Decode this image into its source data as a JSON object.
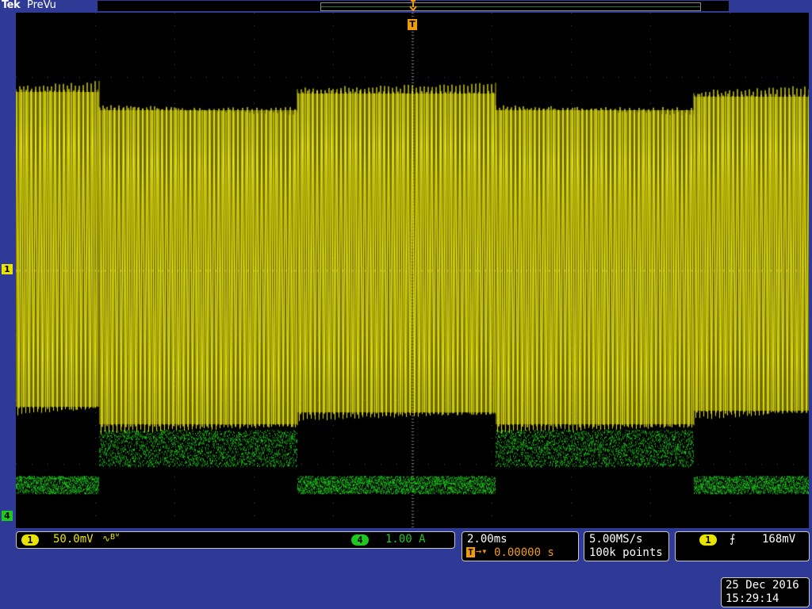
{
  "header": {
    "brand": "Tek",
    "status": "PreVu"
  },
  "markers": {
    "ch1": "1",
    "ch4": "4",
    "trigger": "T"
  },
  "channel1": {
    "label": "1",
    "scale": "50.0mV",
    "coupling_symbol": "∿",
    "bw_symbol": "Bᵂ",
    "color": "#e8e400"
  },
  "channel4": {
    "label": "4",
    "scale": "1.00 A",
    "color": "#1ec81e"
  },
  "horizontal": {
    "timebase": "2.00ms",
    "trigger_position_icon": "T",
    "arrow": "→▾",
    "delay": "0.00000 s"
  },
  "acquisition": {
    "sample_rate": "5.00MS/s",
    "record_length": "100k points"
  },
  "trigger": {
    "source": "1",
    "slope_symbol": "⨍",
    "level": "168mV"
  },
  "datetime": {
    "date": "25 Dec 2016",
    "time": "15:29:14"
  },
  "colors": {
    "background": "#2e3a96",
    "screen": "#000000",
    "trigger": "#f09a10"
  }
}
